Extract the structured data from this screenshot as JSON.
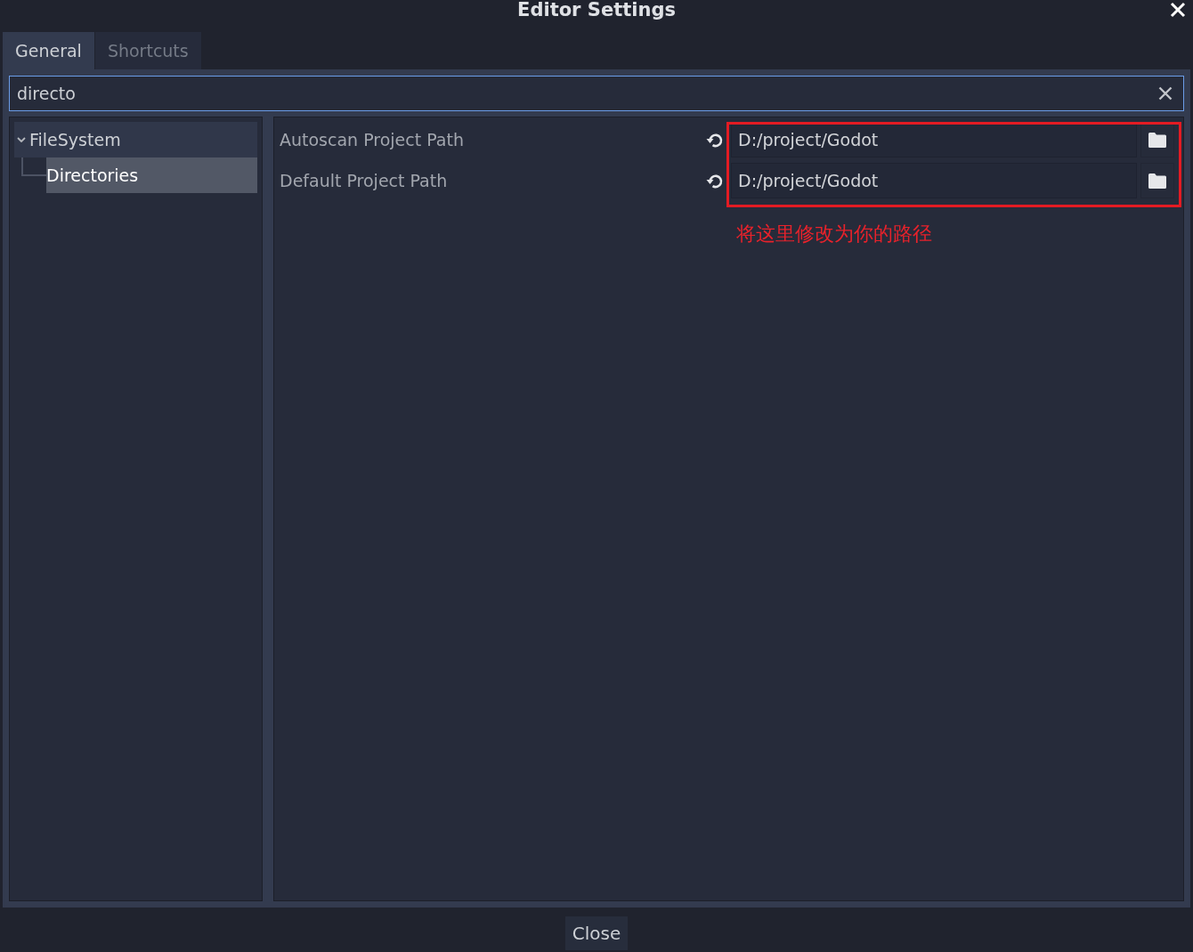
{
  "window": {
    "title": "Editor Settings"
  },
  "tabs": [
    {
      "label": "General",
      "selected": true
    },
    {
      "label": "Shortcuts",
      "selected": false
    }
  ],
  "search": {
    "value": "directo"
  },
  "tree": [
    {
      "label": "FileSystem",
      "expanded": true,
      "selected": false,
      "children": [
        {
          "label": "Directories",
          "selected": true
        }
      ]
    }
  ],
  "properties": [
    {
      "label": "Autoscan Project Path",
      "value": "D:/project/Godot",
      "modified": true
    },
    {
      "label": "Default Project Path",
      "value": "D:/project/Godot",
      "modified": true
    }
  ],
  "annotation": {
    "text": "将这里修改为你的路径"
  },
  "buttons": [
    {
      "label": "Close"
    }
  ]
}
